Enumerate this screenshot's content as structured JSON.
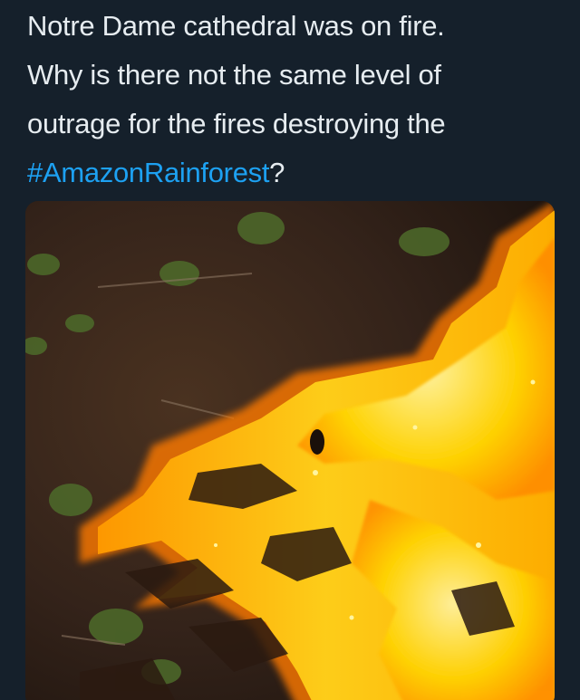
{
  "tweet": {
    "line1": "Notre Dame cathedral was on fire.",
    "line2": "Why is there not the same level of",
    "line3": "outrage for the fires destroying the",
    "hashtag": "#AmazonRainforest",
    "after_hashtag": "?"
  },
  "colors": {
    "background": "#15202b",
    "text": "#e6ecf0",
    "hashtag": "#1da1f2"
  },
  "media": {
    "icon": "wildfire-photo"
  }
}
